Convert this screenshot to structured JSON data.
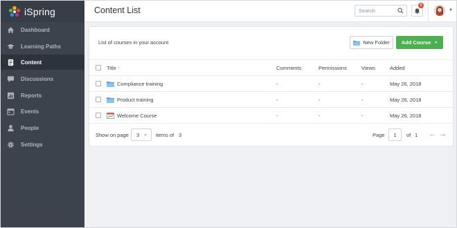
{
  "app": {
    "name": "iSpring"
  },
  "sidebar": {
    "items": [
      {
        "label": "Dashboard",
        "icon": "home-icon",
        "active": false
      },
      {
        "label": "Learning Paths",
        "icon": "graduation-cap-icon",
        "active": false
      },
      {
        "label": "Content",
        "icon": "document-icon",
        "active": true
      },
      {
        "label": "Discussions",
        "icon": "chat-icon",
        "active": false
      },
      {
        "label": "Reports",
        "icon": "chart-icon",
        "active": false
      },
      {
        "label": "Events",
        "icon": "calendar-icon",
        "active": false
      },
      {
        "label": "People",
        "icon": "person-icon",
        "active": false
      },
      {
        "label": "Settings",
        "icon": "gear-icon",
        "active": false
      }
    ]
  },
  "header": {
    "title": "Content List",
    "search_placeholder": "Search",
    "notification_count": "6"
  },
  "panel": {
    "subtitle": "List of courses in your account",
    "new_folder_label": "New Folder",
    "add_course_label": "Add Course"
  },
  "table": {
    "columns": [
      "Title",
      "Comments",
      "Permissions",
      "Views",
      "Added"
    ],
    "rows": [
      {
        "title": "Compliance training",
        "type": "folder-icon",
        "comments": "-",
        "permissions": "-",
        "views": "-",
        "added": "May 26, 2018"
      },
      {
        "title": "Product training",
        "type": "folder-icon",
        "comments": "-",
        "permissions": "-",
        "views": "-",
        "added": "May 26, 2018"
      },
      {
        "title": "Welcome Course",
        "type": "course-icon",
        "comments": "-",
        "permissions": "-",
        "views": "-",
        "added": "May 26, 2018"
      }
    ]
  },
  "pagination": {
    "show_on_page_label": "Show on page",
    "per_page": "3",
    "items_of_label": "items of",
    "total_items": "3",
    "page_label": "Page",
    "current_page": "1",
    "of_label": "of",
    "total_pages": "1"
  },
  "colors": {
    "sidebar": "#3c434d",
    "accent_green": "#4cb050",
    "badge_red": "#e04b3a"
  }
}
